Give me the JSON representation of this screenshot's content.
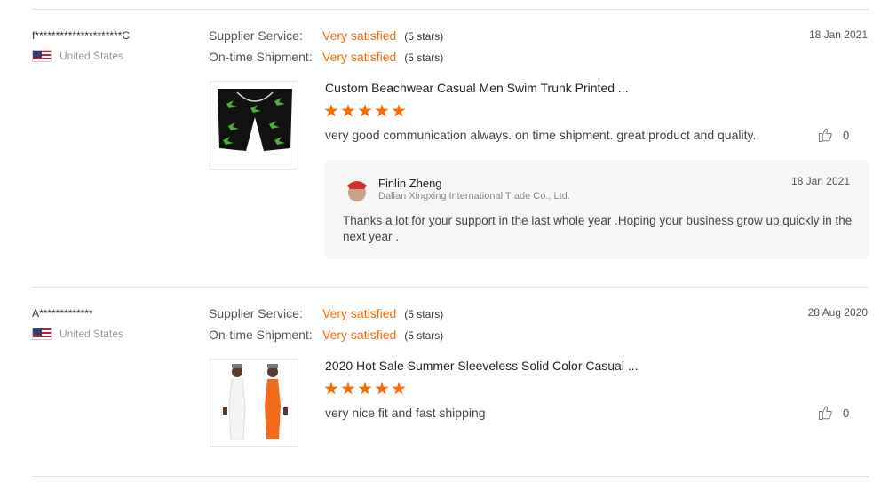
{
  "labels": {
    "supplier_service": "Supplier Service:",
    "ontime_shipment": "On-time Shipment:"
  },
  "reviews": [
    {
      "user": "f*********************C",
      "country": "United States",
      "supplier_rating": "Very satisfied",
      "supplier_stars": "(5 stars)",
      "shipment_rating": "Very satisfied",
      "shipment_stars": "(5 stars)",
      "date": "18 Jan 2021",
      "product_title": "Custom Beachwear Casual Men Swim Trunk Printed ...",
      "star_count": 5,
      "comment": "very good communication always. on time shipment. great product and quality.",
      "likes": "0",
      "reply": {
        "name": "Finlin Zheng",
        "company": "Dalian Xingxing International Trade Co., Ltd.",
        "date": "18 Jan 2021",
        "text": "Thanks a lot for your support in the last  whole year .Hoping your business grow up quickly in the next year ."
      }
    },
    {
      "user": "A*************",
      "country": "United States",
      "supplier_rating": "Very satisfied",
      "supplier_stars": "(5 stars)",
      "shipment_rating": "Very satisfied",
      "shipment_stars": "(5 stars)",
      "date": "28 Aug 2020",
      "product_title": "2020 Hot Sale Summer Sleeveless Solid Color Casual ...",
      "star_count": 5,
      "comment": "very nice fit and fast shipping",
      "likes": "0"
    }
  ],
  "colors": {
    "accent": "#ff6a00",
    "divider": "#e0e0e0",
    "reply_bg": "#f6f6f6"
  },
  "icons": [
    "us-flag-icon",
    "star-icon",
    "thumbs-up-icon",
    "supplier-avatar-icon"
  ]
}
